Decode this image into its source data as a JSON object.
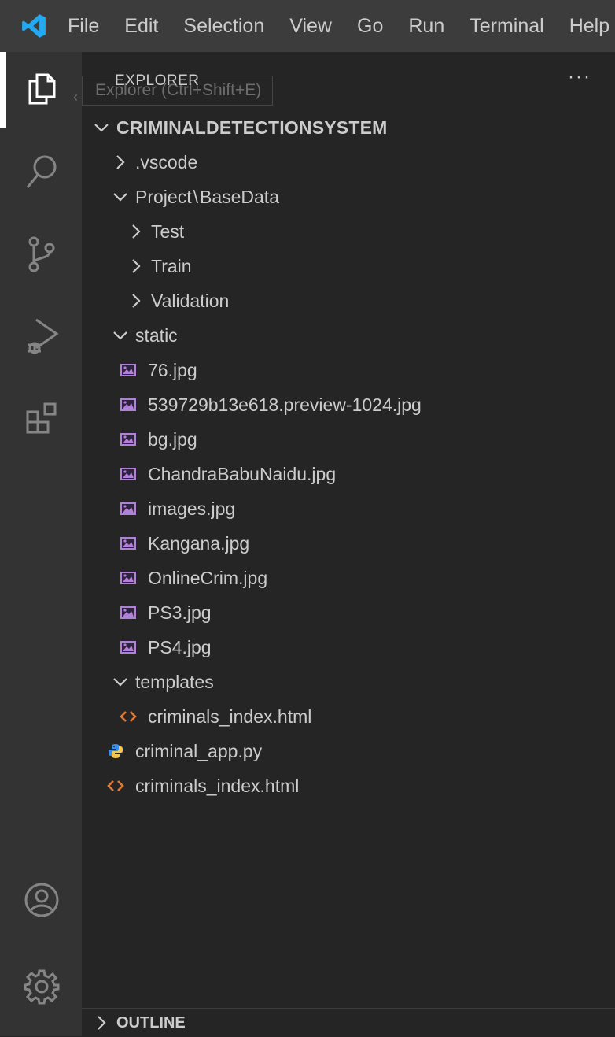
{
  "menubar": {
    "items": [
      "File",
      "Edit",
      "Selection",
      "View",
      "Go",
      "Run",
      "Terminal",
      "Help"
    ]
  },
  "activitybar": {
    "icons": [
      "explorer-icon",
      "search-icon",
      "source-control-icon",
      "run-debug-icon",
      "extensions-icon",
      "accounts-icon",
      "manage-gear-icon"
    ]
  },
  "explorer": {
    "header": "EXPLORER",
    "tooltip": "Explorer (Ctrl+Shift+E)",
    "more": "···",
    "root": "CRIMINALDETECTIONSYSTEM",
    "items": [
      {
        "label": ".vscode",
        "type": "folder",
        "expanded": false,
        "depth": 1
      },
      {
        "label": "Project",
        "label2": "BaseData",
        "sep": "\\",
        "type": "folder",
        "expanded": true,
        "depth": 1
      },
      {
        "label": "Test",
        "type": "folder",
        "expanded": false,
        "depth": 2
      },
      {
        "label": "Train",
        "type": "folder",
        "expanded": false,
        "depth": 2
      },
      {
        "label": "Validation",
        "type": "folder",
        "expanded": false,
        "depth": 2
      },
      {
        "label": "static",
        "type": "folder",
        "expanded": true,
        "depth": 1
      },
      {
        "label": "76.jpg",
        "type": "image",
        "depth": 2
      },
      {
        "label": "539729b13e618.preview-1024.jpg",
        "type": "image",
        "depth": 2
      },
      {
        "label": "bg.jpg",
        "type": "image",
        "depth": 2
      },
      {
        "label": "ChandraBabuNaidu.jpg",
        "type": "image",
        "depth": 2
      },
      {
        "label": "images.jpg",
        "type": "image",
        "depth": 2
      },
      {
        "label": "Kangana.jpg",
        "type": "image",
        "depth": 2
      },
      {
        "label": "OnlineCrim.jpg",
        "type": "image",
        "depth": 2
      },
      {
        "label": "PS3.jpg",
        "type": "image",
        "depth": 2
      },
      {
        "label": "PS4.jpg",
        "type": "image",
        "depth": 2
      },
      {
        "label": "templates",
        "type": "folder",
        "expanded": true,
        "depth": 1
      },
      {
        "label": "criminals_index.html",
        "type": "html",
        "depth": 2
      },
      {
        "label": "criminal_app.py",
        "type": "python",
        "depth": 1
      },
      {
        "label": "criminals_index.html",
        "type": "html",
        "depth": 1
      }
    ],
    "outline": "OUTLINE"
  },
  "colors": {
    "image_icon": "#b180d7",
    "html_icon": "#e37933",
    "python_icon": "#3b8eea",
    "vscode_blue": "#007acc"
  }
}
